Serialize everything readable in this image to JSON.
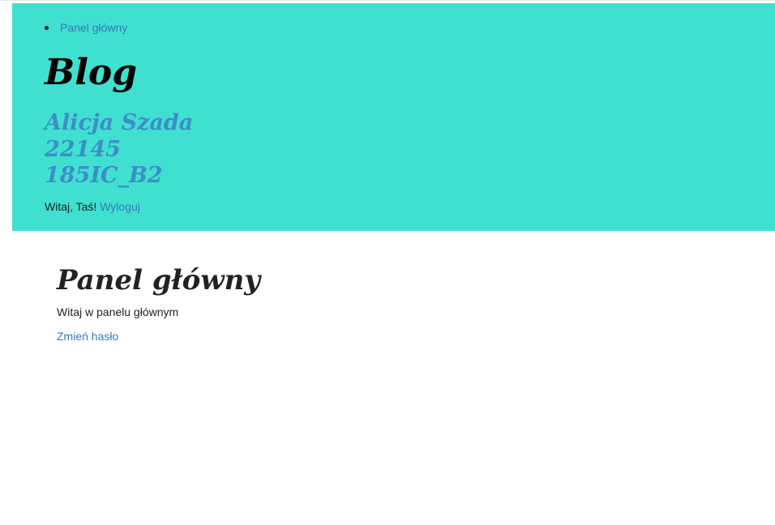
{
  "nav": {
    "items": [
      {
        "label": "Panel główny"
      }
    ]
  },
  "header": {
    "blog_title": "Blog",
    "author_lines": [
      "Alicja Szada",
      "22145",
      "185IC_B2"
    ],
    "greeting": "Witaj, Taś!",
    "logout_label": "Wyloguj"
  },
  "main": {
    "title": "Panel główny",
    "welcome_text": "Witaj w panelu głównym",
    "change_password_label": "Zmień hasło"
  },
  "colors": {
    "header_bg": "#40e0d0",
    "link": "#337ab7",
    "author_text": "#3c8ec9"
  }
}
